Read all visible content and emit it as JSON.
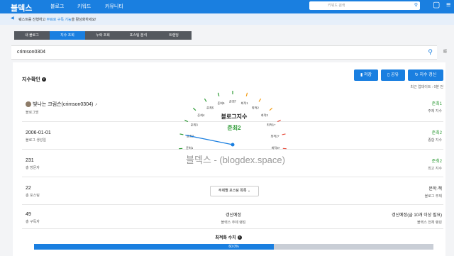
{
  "header": {
    "logo": "블덱스",
    "nav": [
      "블로그",
      "키워드",
      "커뮤니티"
    ],
    "search_placeholder": "키워드 검색"
  },
  "notice": {
    "prefix": "웨스트를 진행하고 ",
    "highlight": "무료로 구독 기능",
    "suffix": "을 활성화하세요!"
  },
  "tabs": [
    "내 블로그",
    "지수 조회",
    "누락 조회",
    "포스팅 분석",
    "트렌딩"
  ],
  "active_tab": 1,
  "search_value": "crimson0304",
  "card": {
    "title": "지수확인",
    "buttons": {
      "save": "저장",
      "share": "공유",
      "refresh": "지수 갱신"
    },
    "updated": "최근 업데이트 : 0분 전",
    "blog_name": "빛나는 크림슨(crimson0304)",
    "blog_name_label": "블로그명",
    "created": "2006-01-01",
    "created_label": "블로그 생성일",
    "visitors": "231",
    "visitors_label": "총 방문자",
    "posts": "22",
    "posts_label": "총 포스팅",
    "subscribers": "49",
    "subscribers_label": "총 구독자",
    "topic_index": "준최1",
    "topic_index_label": "주제 지수",
    "overall_index": "준최2",
    "overall_index_label": "종합 지수",
    "max_index": "준최2",
    "max_index_label": "최고 지수",
    "blog_topic": "문학·책",
    "blog_topic_label": "블로그 주제",
    "topic_rank": "갱신예정",
    "topic_rank_label": "블렉스 주제 랭킹",
    "total_rank": "갱신예정(글 10개 이상 필요)",
    "total_rank_label": "블렉스 전체 랭킹",
    "dropdown": "주제별 포스팅 목록",
    "watermark": "블덱스 - (blogdex.space)"
  },
  "gauge": {
    "title": "블로그지수",
    "value": "준최2",
    "level_index": 2,
    "ticks": [
      "일반",
      "준최1",
      "준최2",
      "준최3",
      "준최4",
      "준최5",
      "준최6",
      "준최7",
      "최적1",
      "최적2",
      "최적3",
      "최적1+",
      "최적2+",
      "최적3+",
      "최적4+"
    ]
  },
  "optimization": {
    "label": "최적화 수치",
    "percent": 60.0,
    "text": "60.0%"
  },
  "colors": {
    "accent": "#1a7fe0",
    "good": "#2e9b36"
  }
}
